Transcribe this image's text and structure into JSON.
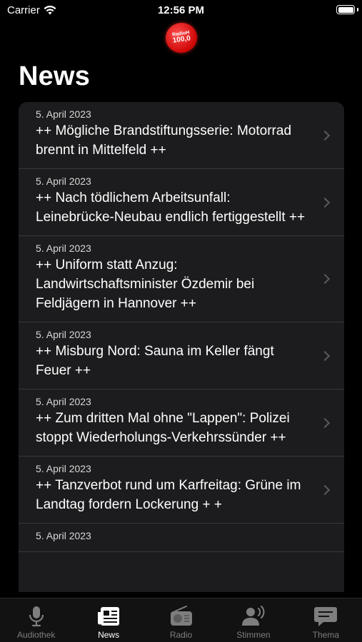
{
  "status": {
    "carrier": "Carrier",
    "time": "12:56 PM"
  },
  "logo": {
    "top": "RadioH",
    "bottom": "100,0"
  },
  "page_title": "News",
  "news": [
    {
      "date": "5. April 2023",
      "title": "++ Mögliche Brandstiftungsserie: Motorrad brennt in Mittelfeld ++"
    },
    {
      "date": "5. April 2023",
      "title": "++ Nach tödlichem Arbeitsunfall: Leinebrücke-Neubau endlich fertiggestellt ++"
    },
    {
      "date": "5. April 2023",
      "title": "++ Uniform statt Anzug: Landwirtschaftsminister Özdemir bei Feldjägern in Hannover ++"
    },
    {
      "date": "5. April 2023",
      "title": "++ Misburg Nord: Sauna im Keller fängt Feuer ++"
    },
    {
      "date": "5. April 2023",
      "title": "++ Zum dritten Mal ohne \"Lappen\": Polizei stoppt Wiederholungs-Verkehrssünder ++"
    },
    {
      "date": "5. April 2023",
      "title": "++ Tanzverbot rund um Karfreitag: Grüne im Landtag fordern Lockerung + +"
    },
    {
      "date": "5. April 2023",
      "title": ""
    }
  ],
  "tabs": [
    {
      "label": "Audiothek",
      "icon": "microphone-icon"
    },
    {
      "label": "News",
      "icon": "newspaper-icon",
      "active": true
    },
    {
      "label": "Radio",
      "icon": "radio-icon"
    },
    {
      "label": "Stimmen",
      "icon": "speaking-person-icon"
    },
    {
      "label": "Thema",
      "icon": "speech-bubble-icon"
    }
  ],
  "colors": {
    "background": "#000000",
    "list": "#1c1c1e",
    "brand": "#e01010",
    "tab_inactive": "#7e7e7e"
  }
}
